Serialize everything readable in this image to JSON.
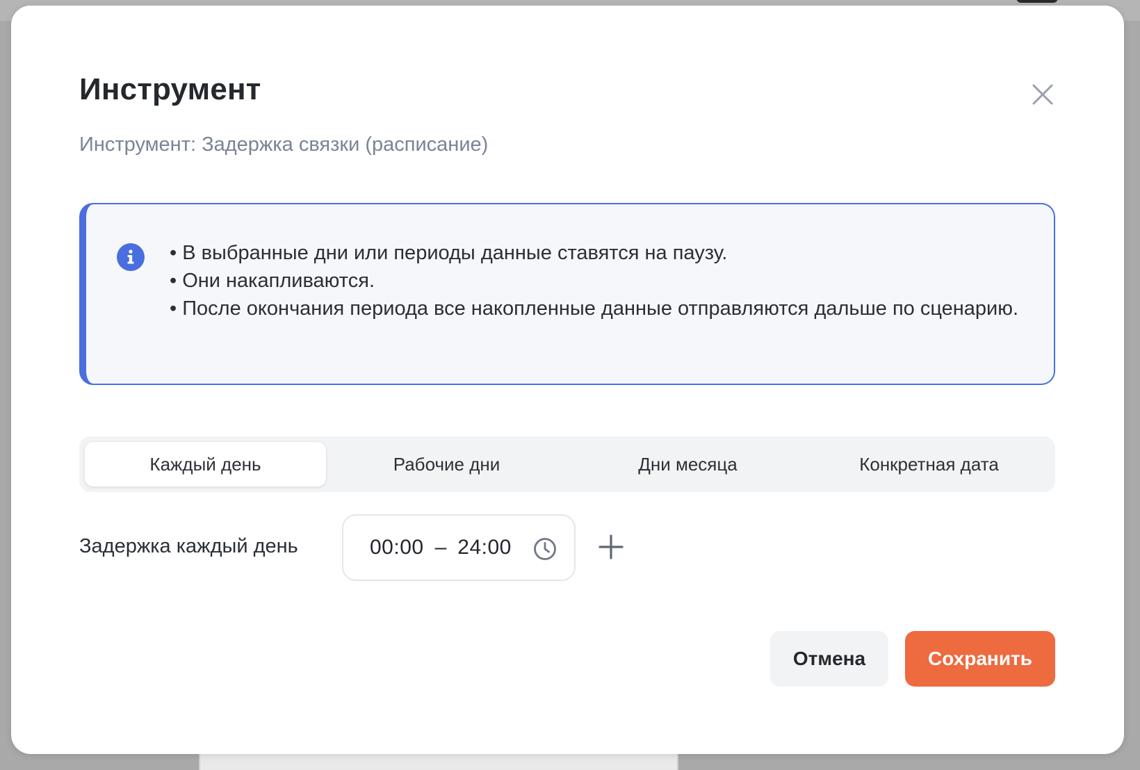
{
  "modal": {
    "title": "Инструмент",
    "subtitle": "Инструмент: Задержка связки (расписание)",
    "close_icon": "close-icon"
  },
  "info": {
    "icon": "info-icon",
    "lines": [
      "• В выбранные дни или периоды данные ставятся на паузу.",
      "• Они накапливаются.",
      "• После окончания периода все накопленные данные отправляются дальше по сценарию."
    ]
  },
  "tabs": [
    {
      "label": "Каждый день",
      "active": true
    },
    {
      "label": "Рабочие дни",
      "active": false
    },
    {
      "label": "Дни месяца",
      "active": false
    },
    {
      "label": "Конкретная дата",
      "active": false
    }
  ],
  "delay": {
    "label": "Задержка каждый день",
    "start": "00:00",
    "separator": "–",
    "end": "24:00",
    "clock_icon": "clock-icon",
    "add_icon": "plus-icon"
  },
  "actions": {
    "cancel_label": "Отмена",
    "save_label": "Сохранить"
  },
  "colors": {
    "accent": "#4a6ee0",
    "primary_button": "#ee6a3f",
    "secondary_button": "#f2f3f5"
  }
}
